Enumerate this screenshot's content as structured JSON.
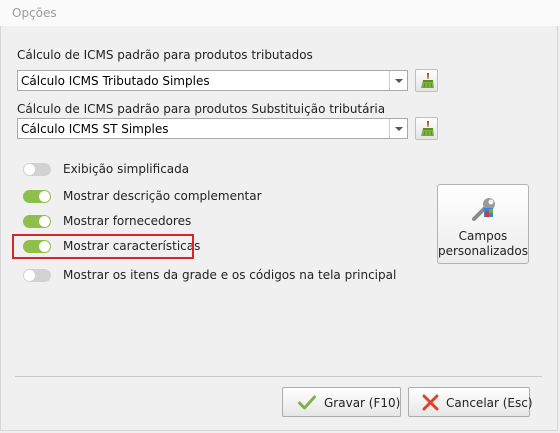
{
  "window": {
    "title": "Opções"
  },
  "section1": {
    "label": "Cálculo de ICMS padrão para produtos tributados",
    "value": "Cálculo ICMS Tributado Simples"
  },
  "section2": {
    "label": "Cálculo de ICMS padrão para produtos Substituição tributária",
    "value": "Cálculo ICMS ST Simples"
  },
  "toggles": [
    {
      "label": "Exibição simplificada",
      "on": false
    },
    {
      "label": "Mostrar descrição complementar",
      "on": true
    },
    {
      "label": "Mostrar fornecedores",
      "on": true
    },
    {
      "label": "Mostrar características",
      "on": true
    },
    {
      "label": "Mostrar os itens da grade e os códigos na tela principal",
      "on": false
    }
  ],
  "custom_fields_button": {
    "line1": "Campos",
    "line2": "personalizados"
  },
  "footer": {
    "save_label": "Gravar (F10)",
    "cancel_label": "Cancelar (Esc)"
  },
  "colors": {
    "toggle_on": "#8dbf4a",
    "toggle_off": "#d2d2d2",
    "highlight": "#d7262b",
    "save_check": "#7fb24a",
    "cancel_x": "#d9452b"
  },
  "icons": [
    "broom-icon",
    "wrench-icon",
    "check-icon",
    "close-icon",
    "chevron-down-icon"
  ]
}
